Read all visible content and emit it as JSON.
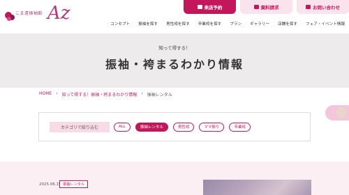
{
  "header": {
    "logo_small": "こま遠振袖館",
    "logo_big": "Az",
    "buttons": {
      "reserve": "来店予約",
      "request": "資料請求",
      "contact": "お問い合わせ"
    }
  },
  "nav": {
    "items": [
      "コンセプト",
      "振袖を探す",
      "男性袴を探す",
      "卒業袴を探す",
      "プラン",
      "ギャラリー",
      "店舗を探す",
      "フェア・イベント情報"
    ]
  },
  "hero": {
    "subtitle": "知って得する！",
    "title": "振袖・袴まるわかり情報"
  },
  "breadcrumb": {
    "home": "HOME",
    "parent": "知って得する！振袖・袴まるわかり情報",
    "current": "振袖レンタル",
    "separator": "›"
  },
  "filter": {
    "label": "カテゴリで絞り込む",
    "tags": [
      {
        "label": "ALL",
        "active": false
      },
      {
        "label": "振袖レンタル",
        "active": true
      },
      {
        "label": "男性袴",
        "active": false
      },
      {
        "label": "ママ振り",
        "active": false
      },
      {
        "label": "卒業袴",
        "active": false
      }
    ]
  },
  "post": {
    "date": "2025.06.19",
    "category": "振袖レンタル"
  },
  "colors": {
    "accent": "#c2185b",
    "accent_light": "#fbe3ee",
    "hero_bg": "#eeebec",
    "section_bg": "#fbeff4"
  }
}
